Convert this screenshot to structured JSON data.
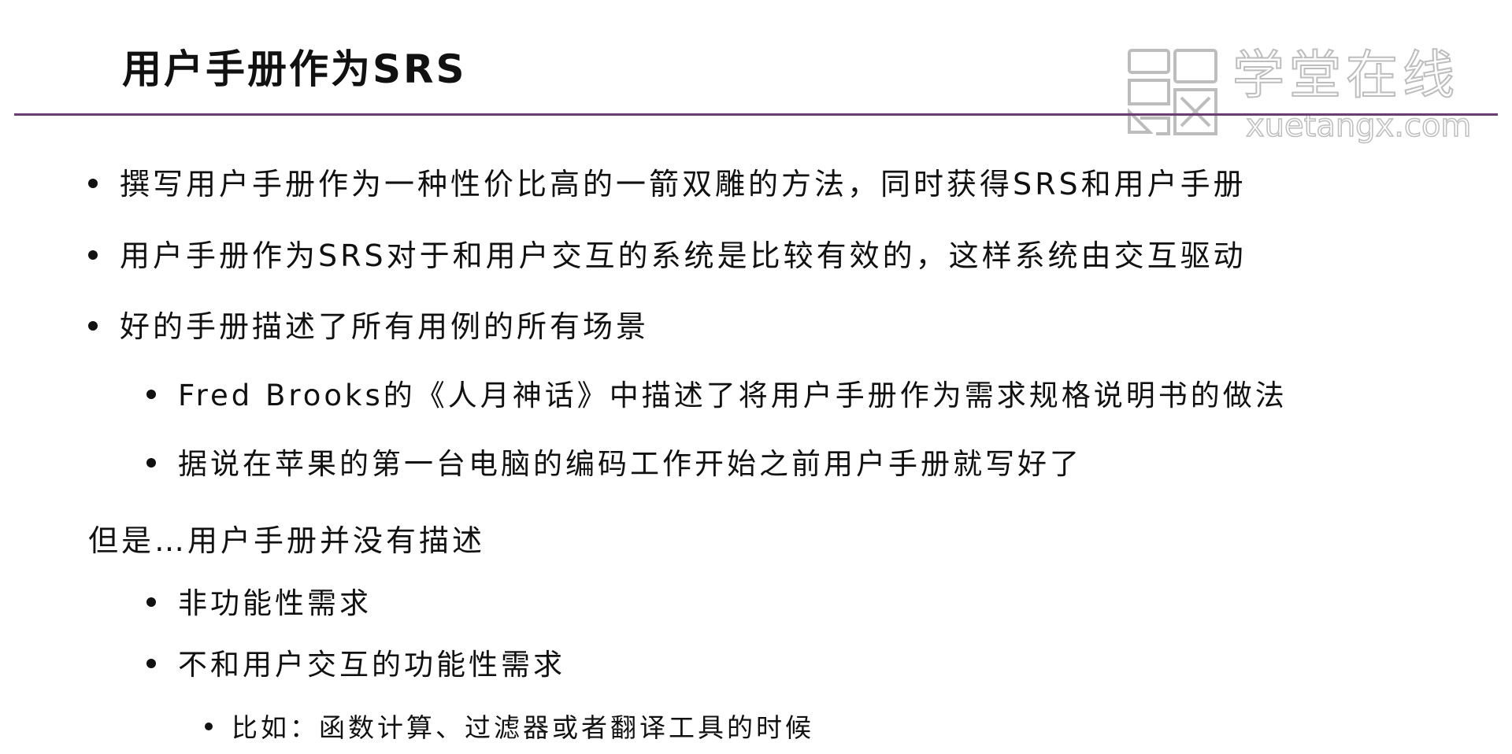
{
  "slide": {
    "title": "用户手册作为SRS",
    "watermark": {
      "chinese": "学堂在线",
      "english": "xuetangx.com"
    },
    "bullets": [
      "撰写用户手册作为一种性价比高的一箭双雕的方法，同时获得SRS和用户手册",
      "用户手册作为SRS对于和用户交互的系统是比较有效的，这样系统由交互驱动",
      "好的手册描述了所有用例的所有场景"
    ],
    "sub_bullets": [
      "Fred Brooks的《人月神话》中描述了将用户手册作为需求规格说明书的做法",
      "据说在苹果的第一台电脑的编码工作开始之前用户手册就写好了"
    ],
    "but_heading": "但是…用户手册并没有描述",
    "but_bullets": [
      "非功能性需求",
      "不和用户交互的功能性需求"
    ],
    "but_sub_bullets": [
      "比如：函数计算、过滤器或者翻译工具的时候"
    ]
  },
  "colors": {
    "rule": "#6b3d72",
    "text": "#111111",
    "watermark_outline": "#bdbdbd"
  }
}
